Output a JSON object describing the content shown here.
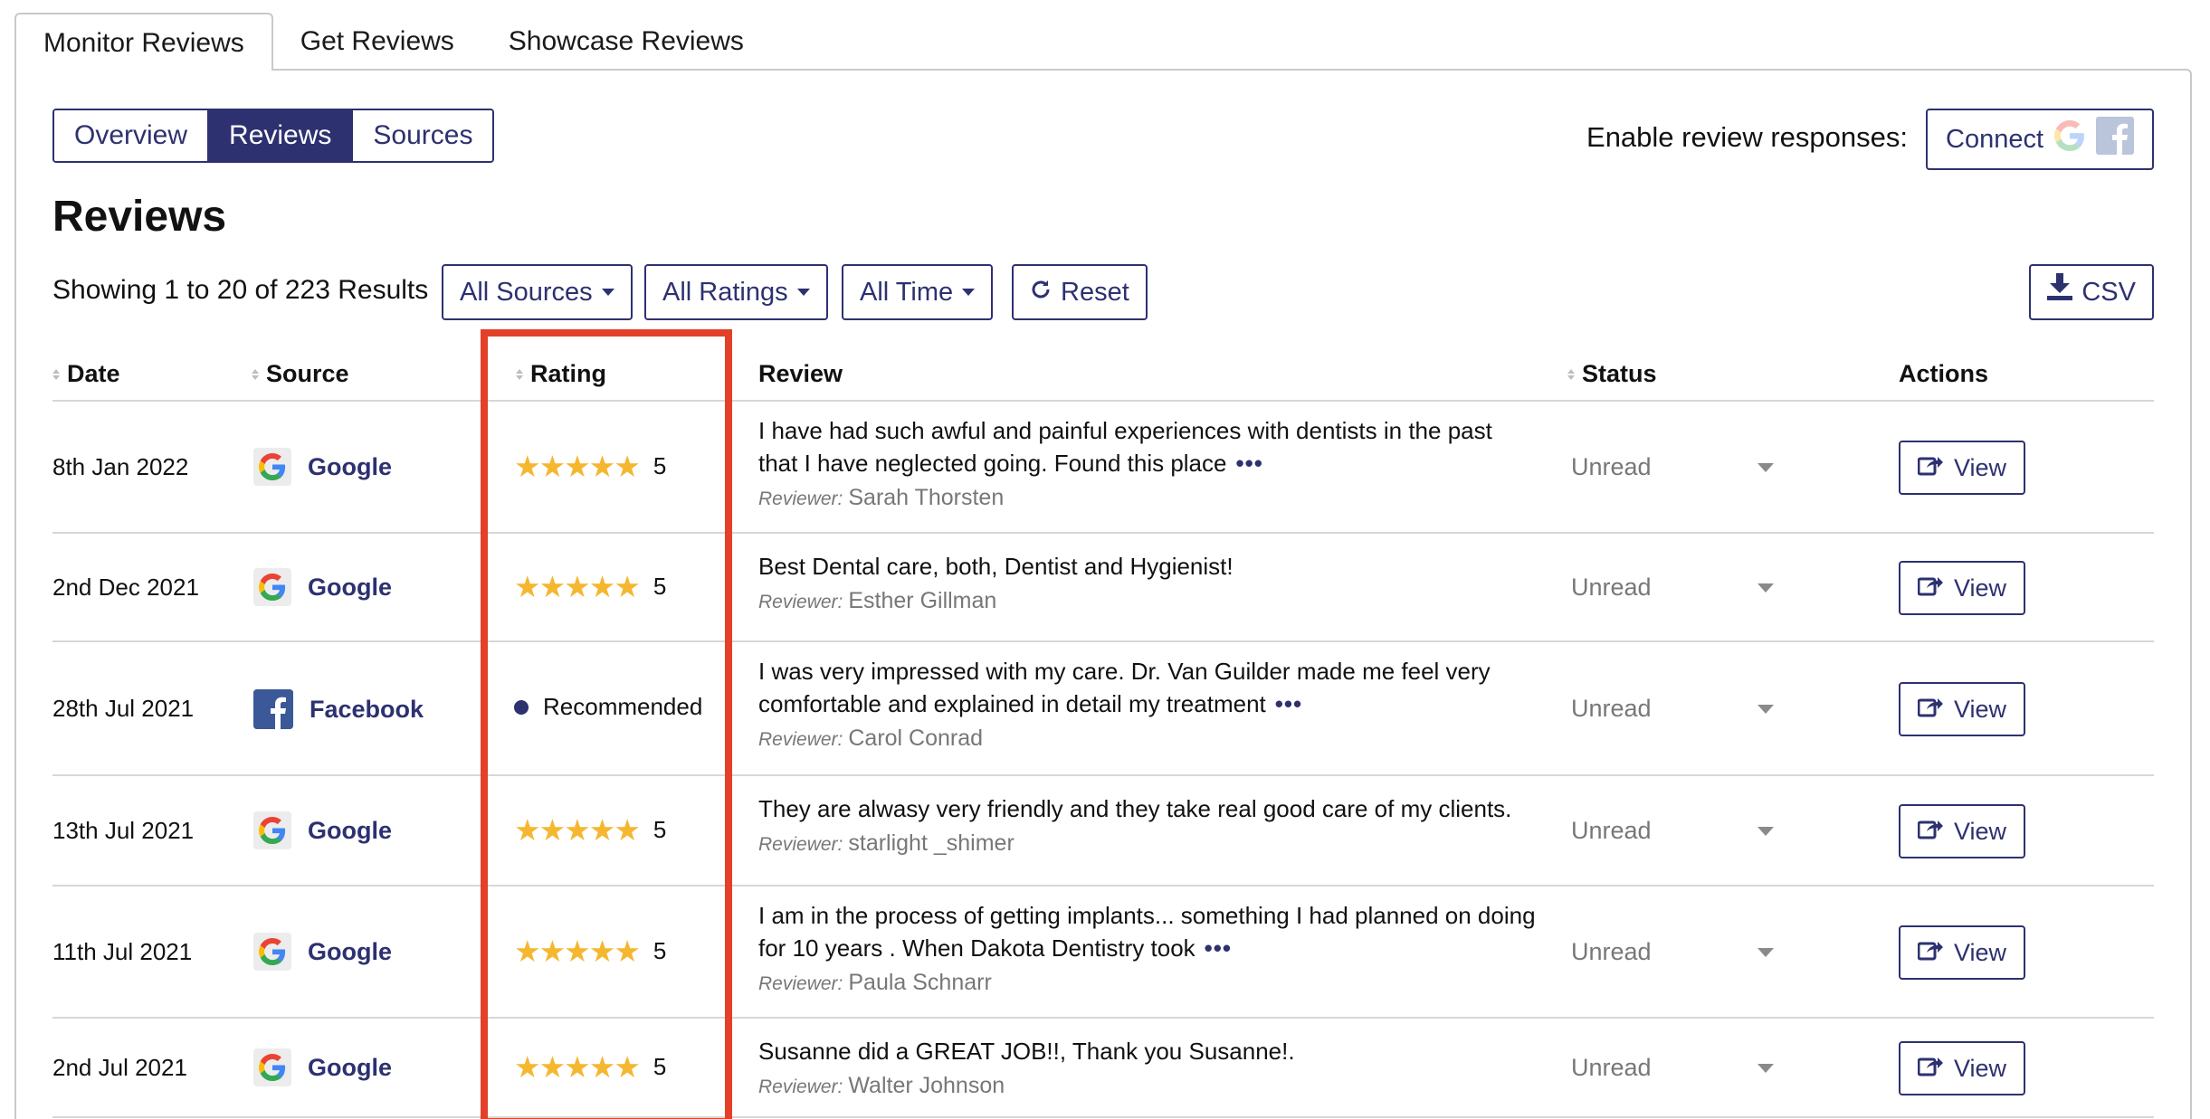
{
  "top_tabs": [
    "Monitor Reviews",
    "Get Reviews",
    "Showcase Reviews"
  ],
  "view_tabs": [
    "Overview",
    "Reviews",
    "Sources"
  ],
  "enable_label": "Enable review responses:",
  "connect_label": "Connect",
  "page_title": "Reviews",
  "results_text": "Showing 1 to 20 of 223 Results",
  "filters": {
    "sources": "All Sources",
    "ratings": "All Ratings",
    "time": "All Time",
    "reset": "Reset",
    "csv": "CSV"
  },
  "columns": {
    "date": "Date",
    "source": "Source",
    "rating": "Rating",
    "review": "Review",
    "status": "Status",
    "actions": "Actions"
  },
  "reviewer_label": "Reviewer:",
  "view_label": "View",
  "more_glyph": "•••",
  "stars_glyph": "★★★★★",
  "rows": [
    {
      "date": "8th Jan 2022",
      "source": "Google",
      "rating": "5",
      "recommended": "",
      "review_line1": "I have had such awful and painful experiences with dentists in the past",
      "review_line2": "that I have neglected going. Found this place",
      "reviewer": "Sarah Thorsten",
      "status": "Unread"
    },
    {
      "date": "2nd Dec 2021",
      "source": "Google",
      "rating": "5",
      "recommended": "",
      "review_line1": "Best Dental care, both, Dentist and Hygienist!",
      "review_line2": "",
      "reviewer": "Esther Gillman",
      "status": "Unread"
    },
    {
      "date": "28th Jul 2021",
      "source": "Facebook",
      "rating": "",
      "recommended": "Recommended",
      "review_line1": "I was very impressed with my care. Dr. Van Guilder made me feel very",
      "review_line2": "comfortable and explained in detail my treatment",
      "reviewer": "Carol Conrad",
      "status": "Unread"
    },
    {
      "date": "13th Jul 2021",
      "source": "Google",
      "rating": "5",
      "recommended": "",
      "review_line1": "They are alwasy very friendly and they take real good care of my clients.",
      "review_line2": "",
      "reviewer": "starlight _shimer",
      "status": "Unread"
    },
    {
      "date": "11th Jul 2021",
      "source": "Google",
      "rating": "5",
      "recommended": "",
      "review_line1": "I am in the process of getting implants... something I had planned on doing",
      "review_line2": "for 10 years . When Dakota Dentistry took",
      "reviewer": "Paula Schnarr",
      "status": "Unread"
    },
    {
      "date": "2nd Jul 2021",
      "source": "Google",
      "rating": "5",
      "recommended": "",
      "review_line1": "Susanne did a GREAT JOB!!, Thank you Susanne!.",
      "review_line2": "",
      "reviewer": "Walter Johnson",
      "status": "Unread"
    }
  ],
  "colors": {
    "accent": "#2d3170",
    "star": "#f5b730",
    "highlight": "#e3402a",
    "facebook": "#3b5998"
  }
}
